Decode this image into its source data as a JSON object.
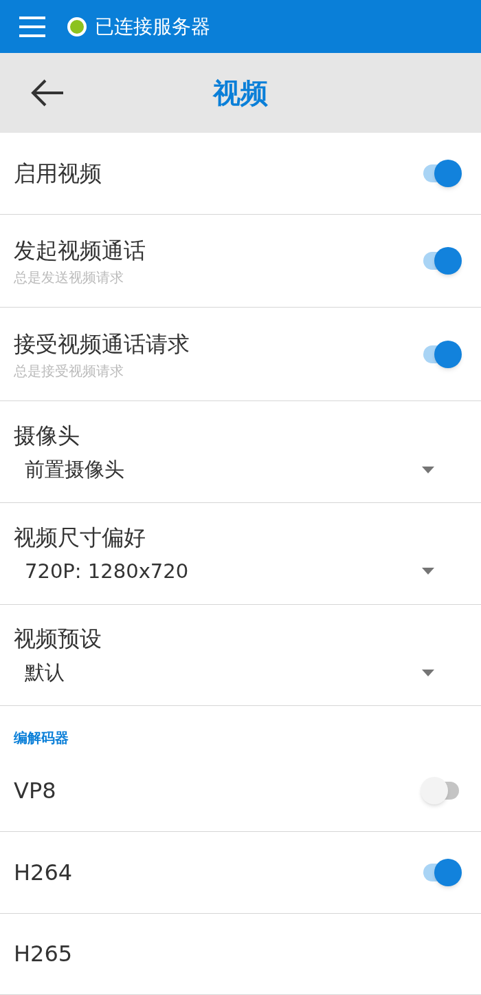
{
  "status_bar": {
    "connected": true,
    "text": "已连接服务器"
  },
  "header": {
    "title": "视频"
  },
  "settings": [
    {
      "kind": "toggle",
      "title": "启用视频",
      "on": true
    },
    {
      "kind": "toggle",
      "title": "发起视频通话",
      "subtitle": "总是发送视频请求",
      "on": true
    },
    {
      "kind": "toggle",
      "title": "接受视频通话请求",
      "subtitle": "总是接受视频请求",
      "on": true
    },
    {
      "kind": "select",
      "title": "摄像头",
      "value": "前置摄像头"
    },
    {
      "kind": "select",
      "title": "视频尺寸偏好",
      "value": "720P: 1280x720"
    },
    {
      "kind": "select",
      "title": "视频预设",
      "value": "默认"
    }
  ],
  "codecs": {
    "heading": "编解码器",
    "items": [
      {
        "kind": "toggle",
        "title": "VP8",
        "on": false
      },
      {
        "kind": "toggle",
        "title": "H264",
        "on": true
      },
      {
        "kind": "label",
        "title": "H265"
      }
    ]
  }
}
